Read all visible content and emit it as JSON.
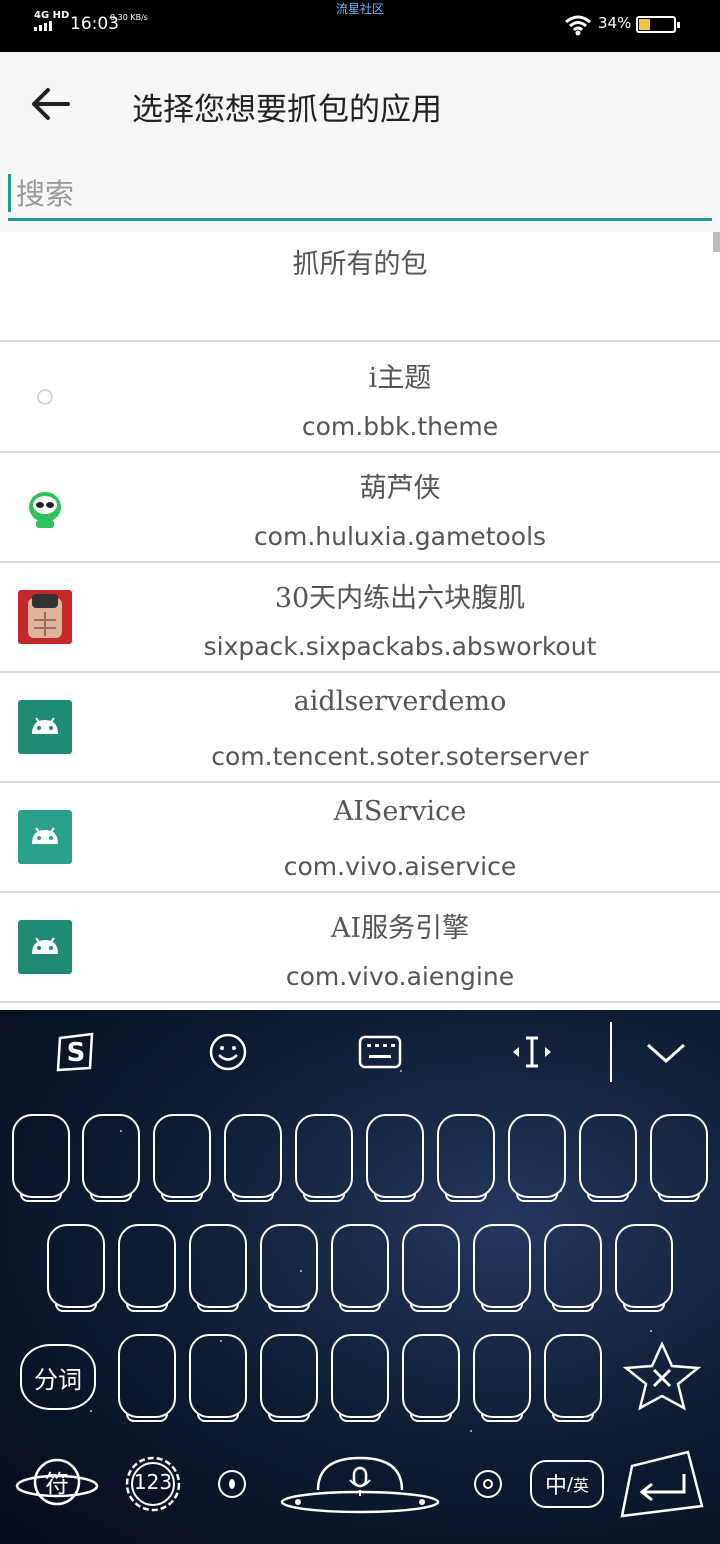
{
  "status_bar": {
    "network": "4G HD",
    "time": "16:03",
    "speed": "0.30 KB/s",
    "center_text": "流星社区",
    "battery": "34%",
    "battery_level": 0.34
  },
  "header": {
    "title": "选择您想要抓包的应用",
    "search_placeholder": "搜索"
  },
  "list": {
    "all_label": "抓所有的包",
    "apps": [
      {
        "name": "i主题",
        "package": "com.bbk.theme",
        "icon": "ring-icon"
      },
      {
        "name": "葫芦侠",
        "package": "com.huluxia.gametools",
        "icon": "huluxia-icon"
      },
      {
        "name": "30天内练出六块腹肌",
        "package": "sixpack.sixpackabs.absworkout",
        "icon": "sixpack-icon"
      },
      {
        "name": "aidlserverdemo",
        "package": "com.tencent.soter.soterserver",
        "icon": "android-icon"
      },
      {
        "name": "AIService",
        "package": "com.vivo.aiservice",
        "icon": "android-icon"
      },
      {
        "name": "AI服务引擎",
        "package": "com.vivo.aiengine",
        "icon": "android-icon"
      }
    ]
  },
  "keyboard": {
    "split_word": "分词",
    "symbol": "符",
    "numbers": "123",
    "lang_zh": "中",
    "lang_en": "英",
    "accent": "#ffffff"
  }
}
